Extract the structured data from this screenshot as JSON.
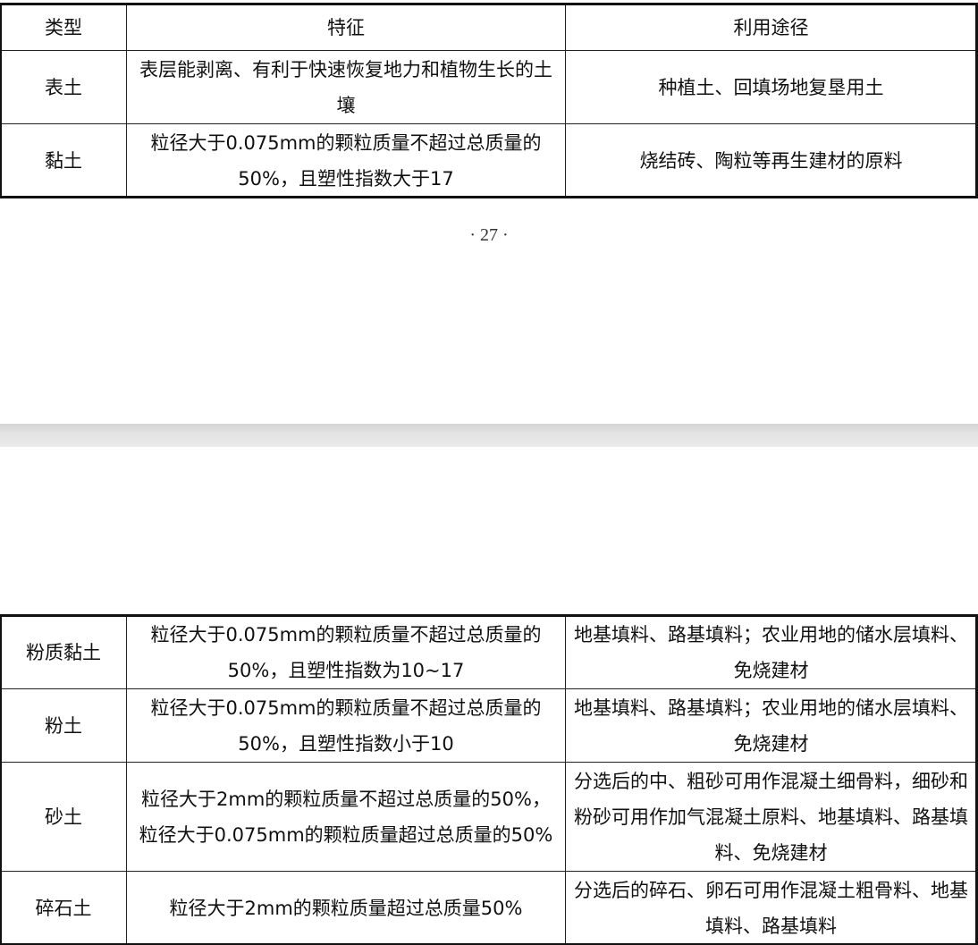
{
  "table_top": {
    "headers": [
      "类型",
      "特征",
      "利用途径"
    ],
    "rows": [
      {
        "type": "表土",
        "feature": "表层能剥离、有利于快速恢复地力和植物生长的土壤",
        "use": "种植土、回填场地复垦用土"
      },
      {
        "type": "黏土",
        "feature": "粒径大于0.075mm的颗粒质量不超过总质量的50%，且塑性指数大于17",
        "use": "烧结砖、陶粒等再生建材的原料"
      }
    ]
  },
  "page_number": "· 27 ·",
  "table_bottom": {
    "rows": [
      {
        "type": "粉质黏土",
        "feature": "粒径大于0.075mm的颗粒质量不超过总质量的50%，且塑性指数为10~17",
        "use": "地基填料、路基填料；农业用地的储水层填料、免烧建材"
      },
      {
        "type": "粉土",
        "feature": "粒径大于0.075mm的颗粒质量不超过总质量的50%，且塑性指数小于10",
        "use": "地基填料、路基填料；农业用地的储水层填料、免烧建材"
      },
      {
        "type": "砂土",
        "feature": "粒径大于2mm的颗粒质量不超过总质量的50%，粒径大于0.075mm的颗粒质量超过总质量的50%",
        "use": "分选后的中、粗砂可用作混凝土细骨料，细砂和粉砂可用作加气混凝土原料、地基填料、路基填料、免烧建材"
      },
      {
        "type": "碎石土",
        "feature": "粒径大于2mm的颗粒质量超过总质量50%",
        "use": "分选后的碎石、卵石可用作混凝土粗骨料、地基填料、路基填料"
      }
    ]
  }
}
